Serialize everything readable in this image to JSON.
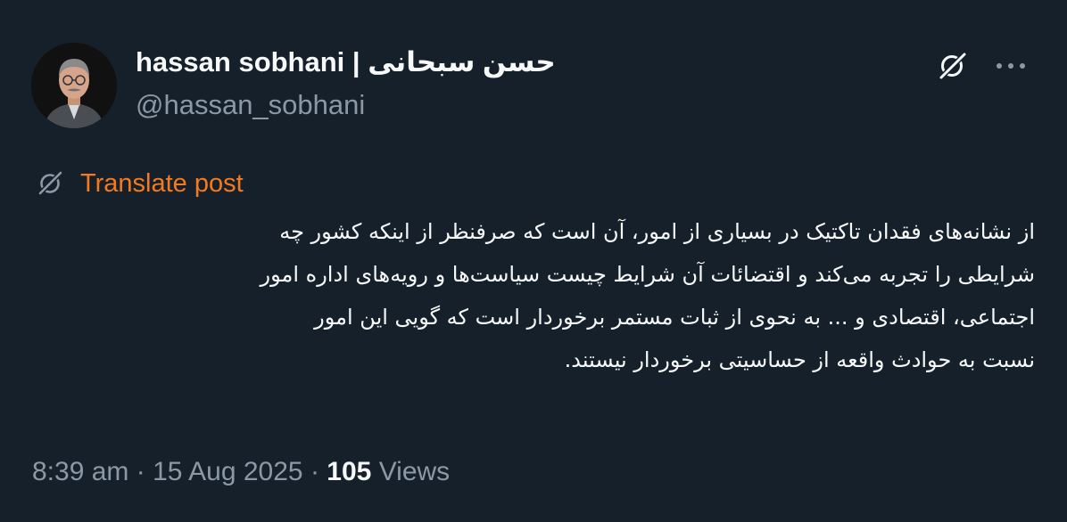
{
  "author": {
    "display_name": "hassan sobhani | حسن سبحانی",
    "handle": "@hassan_sobhani"
  },
  "actions": {
    "grok_icon": "grok-icon",
    "more_icon": "more-horizontal-icon"
  },
  "translate": {
    "label": "Translate post"
  },
  "post": {
    "lines": [
      "از نشانه‌های فقدان تاکتیک در بسیاری از امور، آن است که صرفنظر از اینکه کشور چه",
      "شرایطی را تجربه می‌کند و اقتضائات آن شرایط چیست سیاست‌ها و رویه‌های اداره امور",
      "اجتماعی، اقتصادی و ... به نحوی از ثبات مستمر برخوردار است که گویی این امور",
      "نسبت به حوادث واقعه از حساسیتی برخوردار نیستند."
    ]
  },
  "meta": {
    "time": "8:39 am",
    "separator": "·",
    "date": "15 Aug 2025",
    "views_count": "105",
    "views_label": "Views"
  },
  "colors": {
    "background": "#15202b",
    "text_primary": "#f7f9f9",
    "text_secondary": "#8b98a5",
    "translate_accent": "#f4791f"
  }
}
